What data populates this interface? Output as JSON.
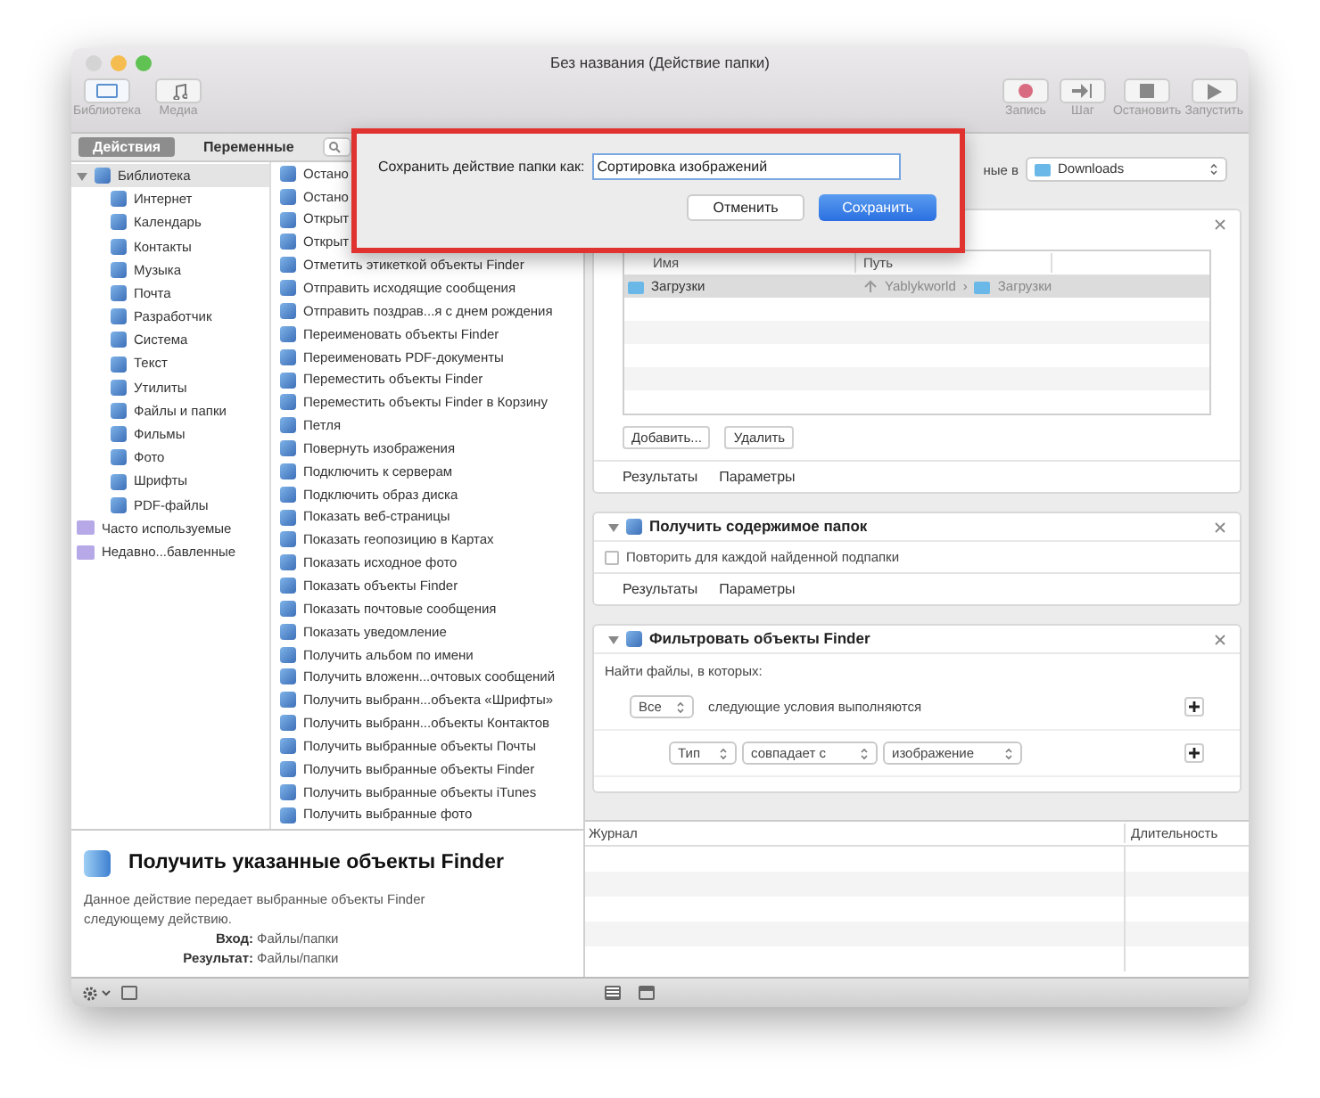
{
  "window": {
    "title": "Без названия (Действие папки)"
  },
  "toolbar": {
    "left": [
      {
        "label": "Библиотека",
        "selected": true
      },
      {
        "label": "Медиа",
        "selected": false
      }
    ],
    "right": [
      {
        "label": "Запись",
        "kind": "record"
      },
      {
        "label": "Шаг",
        "kind": "step"
      },
      {
        "label": "Остановить",
        "kind": "stop"
      },
      {
        "label": "Запустить",
        "kind": "run"
      }
    ]
  },
  "tabs": [
    {
      "label": "Действия",
      "selected": true
    },
    {
      "label": "Переменные",
      "selected": false
    }
  ],
  "library": [
    {
      "label": "Библиотека",
      "kind": "library",
      "selected": true,
      "expanded": true,
      "children": [
        {
          "label": "Интернет"
        },
        {
          "label": "Календарь"
        },
        {
          "label": "Контакты"
        },
        {
          "label": "Музыка"
        },
        {
          "label": "Почта"
        },
        {
          "label": "Разработчик"
        },
        {
          "label": "Система"
        },
        {
          "label": "Текст"
        },
        {
          "label": "Утилиты"
        },
        {
          "label": "Файлы и папки"
        },
        {
          "label": "Фильмы"
        },
        {
          "label": "Фото"
        },
        {
          "label": "Шрифты"
        },
        {
          "label": "PDF-файлы"
        }
      ]
    },
    {
      "label": "Часто используемые",
      "kind": "smart",
      "selected": false
    },
    {
      "label": "Недавно...бавленные",
      "kind": "smart",
      "selected": false
    }
  ],
  "actions": [
    "Остано",
    "Остано",
    "Открыт",
    "Открыт",
    "Отметить этикеткой объекты Finder",
    "Отправить исходящие сообщения",
    "Отправить поздрав...я с днем рождения",
    "Переименовать объекты Finder",
    "Переименовать PDF-документы",
    "Переместить объекты Finder",
    "Переместить объекты Finder в Корзину",
    "Петля",
    "Повернуть изображения",
    "Подключить к серверам",
    "Подключить образ диска",
    "Показать веб-страницы",
    "Показать геопозицию в Картах",
    "Показать исходное фото",
    "Показать объекты Finder",
    "Показать почтовые сообщения",
    "Показать уведомление",
    "Получить альбом по имени",
    "Получить вложенн...очтовых сообщений",
    "Получить выбранн...объекта «Шрифты»",
    "Получить выбранн...объекты Контактов",
    "Получить выбранные объекты Почты",
    "Получить выбранные объекты Finder",
    "Получить выбранные объекты iTunes",
    "Получить выбранные фото"
  ],
  "description": {
    "title": "Получить указанные объекты Finder",
    "text": "Данное действие передает выбранные объекты Finder следующему действию.",
    "fields": [
      {
        "label": "Вход:",
        "value": "Файлы/папки"
      },
      {
        "label": "Результат:",
        "value": "Файлы/папки"
      }
    ]
  },
  "workflow": {
    "folder_label": "ные в",
    "folder": "Downloads",
    "cards": [
      {
        "kind": "items",
        "table": {
          "columns": [
            "Имя",
            "Путь"
          ],
          "rows": [
            {
              "name": "Загрузки",
              "path_user": "Yablykworld",
              "path_sep": "›",
              "path_folder": "Загрузки",
              "selected": true
            }
          ]
        },
        "buttons": [
          "Добавить...",
          "Удалить"
        ],
        "tabs": [
          "Результаты",
          "Параметры"
        ]
      },
      {
        "kind": "contents",
        "title": "Получить содержимое папок",
        "option": {
          "label": "Повторить для каждой найденной подпапки",
          "checked": false
        },
        "tabs": [
          "Результаты",
          "Параметры"
        ]
      },
      {
        "kind": "filter",
        "title": "Фильтровать объекты Finder",
        "prompt": "Найти файлы, в которых:",
        "match": "Все",
        "match_text": "следующие условия выполняются",
        "condition": [
          "Тип",
          "совпадает с",
          "изображение"
        ]
      }
    ]
  },
  "log": {
    "columns": [
      "Журнал",
      "Длительность"
    ]
  },
  "dialog": {
    "label": "Сохранить действие папки как:",
    "value": "Сортировка изображений",
    "buttons": [
      {
        "label": "Отменить",
        "kind": "cancel"
      },
      {
        "label": "Сохранить",
        "kind": "default"
      }
    ]
  }
}
